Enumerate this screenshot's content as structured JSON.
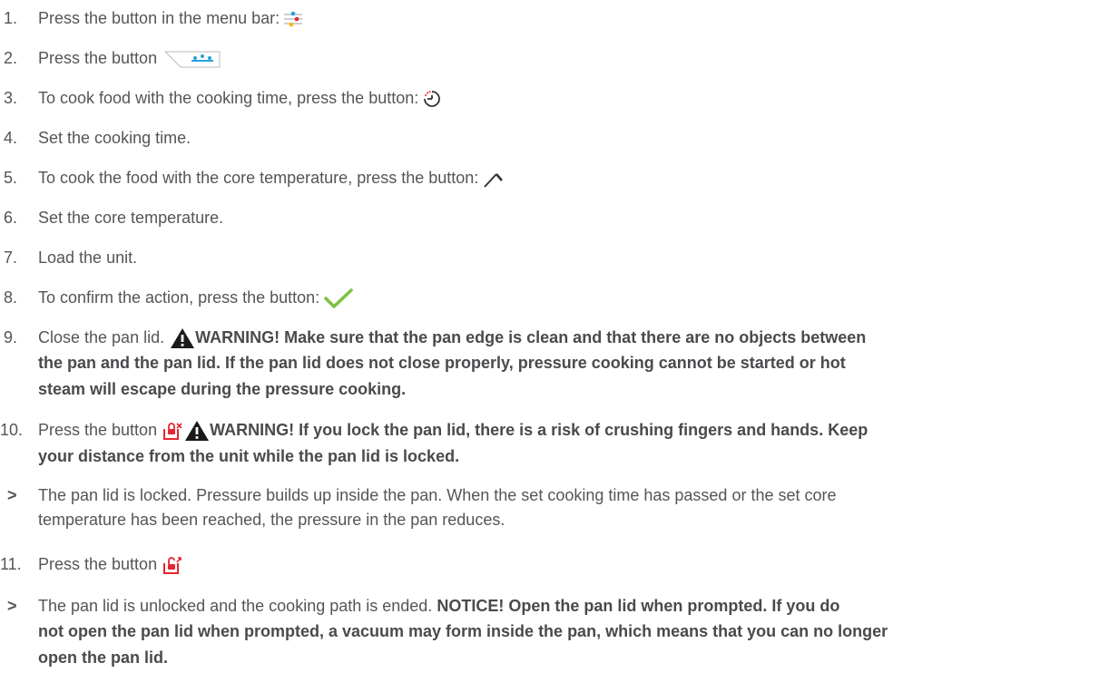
{
  "steps": [
    {
      "num": "1.",
      "text": "Press the button in the menu bar:",
      "icon": "filter-sliders-icon"
    },
    {
      "num": "2.",
      "text": "Press the button",
      "icon": "pressure-cooking-tab-icon"
    },
    {
      "num": "3.",
      "text": "To cook food with the cooking time, press the button:",
      "icon": "timer-icon"
    },
    {
      "num": "4.",
      "text": "Set the cooking time."
    },
    {
      "num": "5.",
      "text": "To cook the food with the core temperature, press the button:",
      "icon": "core-probe-icon"
    },
    {
      "num": "6.",
      "text": "Set the core temperature."
    },
    {
      "num": "7.",
      "text": "Load the unit."
    },
    {
      "num": "8.",
      "text": "To confirm the action, press the button:",
      "icon": "checkmark-icon"
    },
    {
      "num": "9.",
      "text": "Close the pan lid.",
      "warning_lines": [
        "WARNING! Make sure that the pan edge is clean and that there are no objects between",
        "the pan and the pan lid. If the pan lid does not close properly, pressure cooking cannot be started or hot",
        "steam will escape during the pressure cooking."
      ]
    },
    {
      "num": "10.",
      "text": "Press the button",
      "icon": "lock-lid-icon",
      "warning_lines": [
        "WARNING! If you lock the pan lid, there is a risk of crushing fingers and hands. Keep",
        "your distance from the unit while the pan lid is locked."
      ]
    },
    {
      "result_marker": ">",
      "result_lines": [
        "The pan lid is locked. Pressure builds up inside the pan. When the set cooking time has passed or the set core",
        "temperature has been reached, the pressure in the pan reduces."
      ]
    },
    {
      "num": "11.",
      "text": "Press the button",
      "icon": "unlock-lid-icon"
    },
    {
      "result_marker": ">",
      "result_text": "The pan lid is unlocked and the cooking path is ended.",
      "notice_lines": [
        "NOTICE! Open the pan lid when prompted. If you do",
        "not open the pan lid when prompted, a vacuum may form inside the pan, which means that you can no longer",
        "open the pan lid."
      ]
    }
  ],
  "colors": {
    "text": "#555559",
    "warning_triangle": "#1a1a1a",
    "check_green": "#7cc242",
    "accent_blue": "#2b9fd8",
    "accent_red": "#e3262f",
    "accent_yellow": "#f5b800"
  }
}
